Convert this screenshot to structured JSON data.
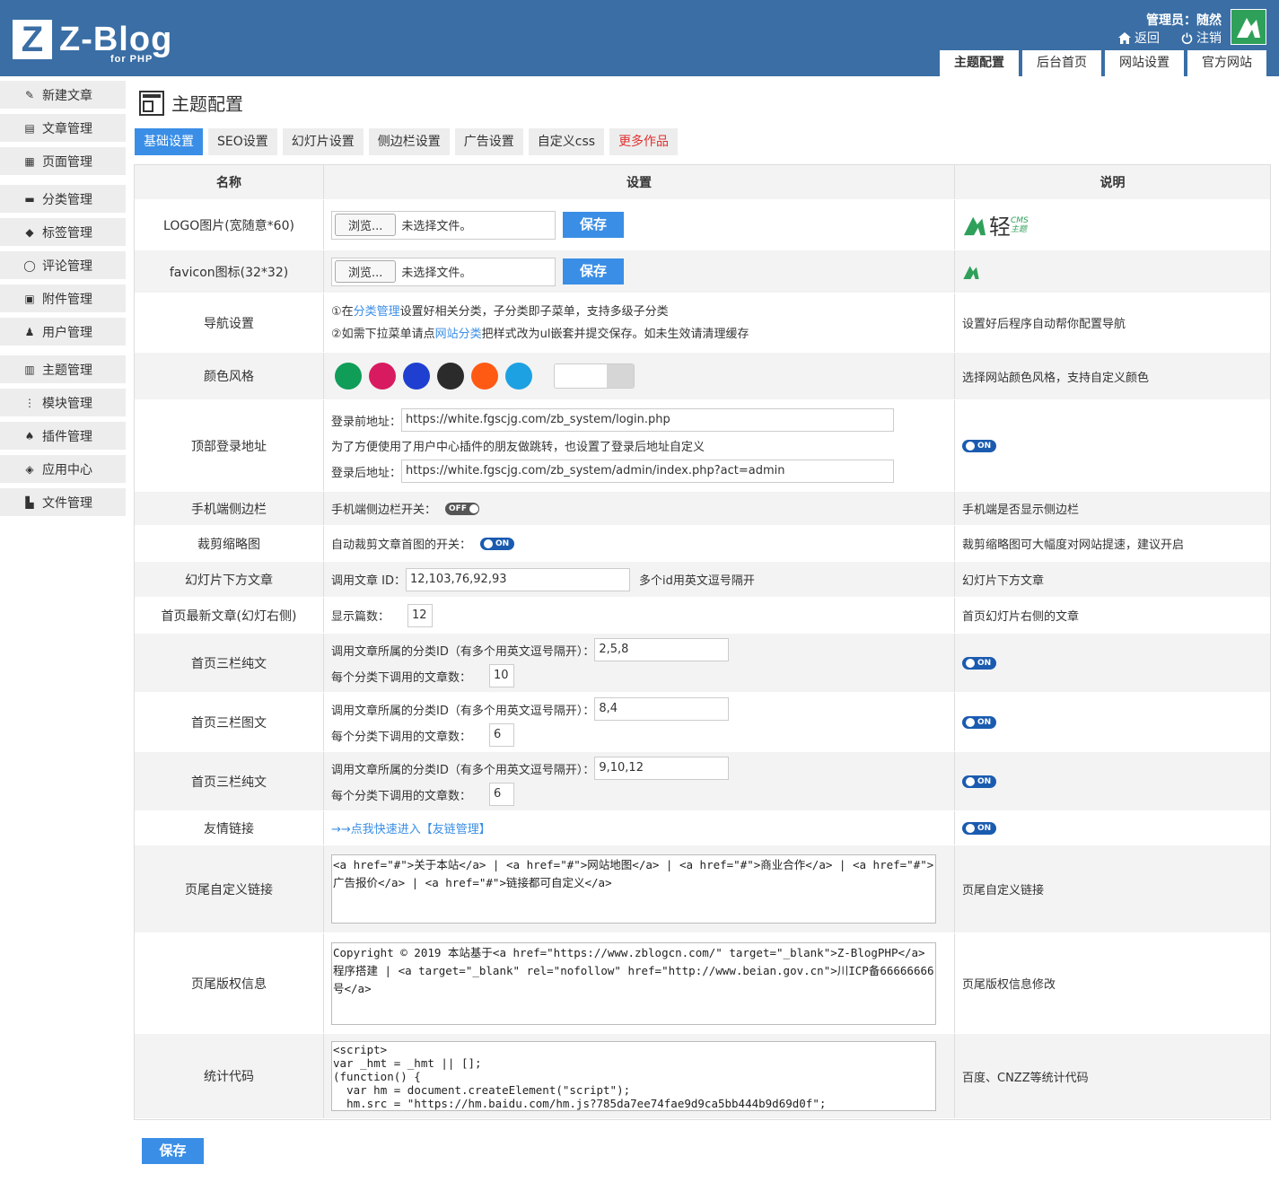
{
  "header": {
    "logo_letter": "Z",
    "logo_text": "Z-Blog",
    "logo_sub": "for PHP",
    "admin_label": "管理员：随然",
    "back_label": "返回",
    "logout_label": "注销",
    "tabs": [
      "主题配置",
      "后台首页",
      "网站设置",
      "官方网站"
    ]
  },
  "sidebar": {
    "items": [
      "新建文章",
      "文章管理",
      "页面管理",
      "分类管理",
      "标签管理",
      "评论管理",
      "附件管理",
      "用户管理",
      "主题管理",
      "模块管理",
      "插件管理",
      "应用中心",
      "文件管理"
    ]
  },
  "page": {
    "title": "主题配置",
    "subtabs": [
      "基础设置",
      "SEO设置",
      "幻灯片设置",
      "侧边栏设置",
      "广告设置",
      "自定义css",
      "更多作品"
    ]
  },
  "table": {
    "headers": [
      "名称",
      "设置",
      "说明"
    ],
    "logo": {
      "name": "LOGO图片(宽随意*60)",
      "browse": "浏览...",
      "nofile": "未选择文件。",
      "save": "保存",
      "brand": "轻",
      "brand_sub_top": "CMS",
      "brand_sub_bottom": "主题"
    },
    "favicon": {
      "name": "favicon图标(32*32)",
      "browse": "浏览...",
      "nofile": "未选择文件。",
      "save": "保存"
    },
    "nav": {
      "name": "导航设置",
      "l1_a": "①在",
      "l1_link": "分类管理",
      "l1_b": "设置好相关分类，子分类即子菜单，支持多级子分类",
      "l2_a": "②如需下拉菜单请点",
      "l2_link": "网站分类",
      "l2_b": "把样式改为ul嵌套并提交保存。如未生效请清理缓存",
      "desc": "设置好后程序自动帮你配置导航"
    },
    "color": {
      "name": "颜色风格",
      "colors": [
        "#0f9d58",
        "#d81b60",
        "#1e3fd0",
        "#2b2b2b",
        "#ff5a13",
        "#1da1e2"
      ],
      "desc": "选择网站颜色风格，支持自定义颜色"
    },
    "login": {
      "name": "顶部登录地址",
      "before_label": "登录前地址：",
      "before_value": "https://white.fgscjg.com/zb_system/login.php",
      "note": "为了方便使用了用户中心插件的朋友做跳转，也设置了登录后地址自定义",
      "after_label": "登录后地址：",
      "after_value": "https://white.fgscjg.com/zb_system/admin/index.php?act=admin",
      "toggle": "ON"
    },
    "mobile": {
      "name": "手机端侧边栏",
      "label": "手机端侧边栏开关：",
      "toggle": "OFF",
      "desc": "手机端是否显示侧边栏"
    },
    "thumb": {
      "name": "裁剪缩略图",
      "label": "自动裁剪文章首图的开关：",
      "toggle": "ON",
      "desc": "裁剪缩略图可大幅度对网站提速，建议开启"
    },
    "slide": {
      "name": "幻灯片下方文章",
      "label": "调用文章 ID：",
      "value": "12,103,76,92,93",
      "hint": "多个id用英文逗号隔开",
      "desc": "幻灯片下方文章"
    },
    "latest": {
      "name": "首页最新文章(幻灯右侧)",
      "label": "显示篇数：",
      "value": "12",
      "desc": "首页幻灯片右侧的文章"
    },
    "three1": {
      "name": "首页三栏纯文",
      "cat_label": "调用文章所属的分类ID（有多个用英文逗号隔开）：",
      "cat_value": "2,5,8",
      "count_label": "每个分类下调用的文章数：",
      "count_value": "10",
      "toggle": "ON"
    },
    "three2": {
      "name": "首页三栏图文",
      "cat_label": "调用文章所属的分类ID（有多个用英文逗号隔开）：",
      "cat_value": "8,4",
      "count_label": "每个分类下调用的文章数：",
      "count_value": "6",
      "toggle": "ON"
    },
    "three3": {
      "name": "首页三栏纯文",
      "cat_label": "调用文章所属的分类ID（有多个用英文逗号隔开）：",
      "cat_value": "9,10,12",
      "count_label": "每个分类下调用的文章数：",
      "count_value": "6",
      "toggle": "ON"
    },
    "friend": {
      "name": "友情链接",
      "link": "→→点我快速进入【友链管理】",
      "toggle": "ON"
    },
    "footer_links": {
      "name": "页尾自定义链接",
      "value": "<a href=\"#\">关于本站</a> | <a href=\"#\">网站地图</a> | <a href=\"#\">商业合作</a> | <a href=\"#\">广告报价</a> | <a href=\"#\">链接都可自定义</a>",
      "desc": "页尾自定义链接"
    },
    "copyright": {
      "name": "页尾版权信息",
      "value": "Copyright © 2019 本站基于<a href=\"https://www.zblogcn.com/\" target=\"_blank\">Z-BlogPHP</a>程序搭建 | <a target=\"_blank\" rel=\"nofollow\" href=\"http://www.beian.gov.cn\">川ICP备66666666号</a>",
      "desc": "页尾版权信息修改"
    },
    "stats": {
      "name": "统计代码",
      "value": "<script>\nvar _hmt = _hmt || [];\n(function() {\n  var hm = document.createElement(\"script\");\n  hm.src = \"https://hm.baidu.com/hm.js?785da7ee74fae9d9ca5bb444b9d69d0f\";",
      "desc": "百度、CNZZ等统计代码"
    }
  },
  "bottom_save": "保存"
}
